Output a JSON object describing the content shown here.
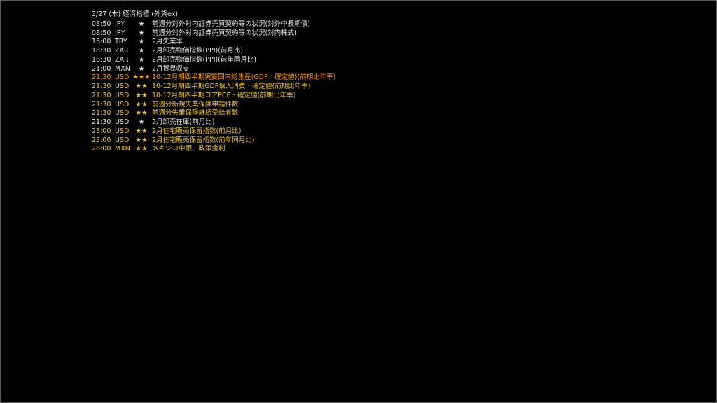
{
  "header": {
    "date_label": "3/27 (木) 経済指標 (外貨ex)"
  },
  "events": [
    {
      "time": "08:50",
      "currency": "JPY",
      "stars": "★",
      "title": "前週分対外対内証券売買契約等の状況(対外中長期債)",
      "color": "normal"
    },
    {
      "time": "08:50",
      "currency": "JPY",
      "stars": "★",
      "title": "前週分対外対内証券売買契約等の状況(対内株式)",
      "color": "normal"
    },
    {
      "time": "16:00",
      "currency": "TRY",
      "stars": "★",
      "title": "2月失業率",
      "color": "normal"
    },
    {
      "time": "18:30",
      "currency": "ZAR",
      "stars": "★",
      "title": "2月卸売物価指数(PPI)(前月比)",
      "color": "normal"
    },
    {
      "time": "18:30",
      "currency": "ZAR",
      "stars": "★",
      "title": "2月卸売物価指数(PPI)(前年同月比)",
      "color": "normal"
    },
    {
      "time": "21:00",
      "currency": "MXN",
      "stars": "★",
      "title": "2月貿易収支",
      "color": "normal"
    },
    {
      "time": "21:30",
      "currency": "USD",
      "stars": "★★★",
      "title": "10-12月期四半期実質国内総生産(GDP、確定値)(前期比年率)",
      "color": "orange"
    },
    {
      "time": "21:30",
      "currency": "USD",
      "stars": "★★",
      "title": "10-12月期四半期GDP個人消費・確定値(前期比年率)",
      "color": "gold"
    },
    {
      "time": "21:30",
      "currency": "USD",
      "stars": "★★",
      "title": "10-12月期四半期コアPCE・確定値(前期比年率)",
      "color": "gold"
    },
    {
      "time": "21:30",
      "currency": "USD",
      "stars": "★★",
      "title": "前週分新規失業保険申請件数",
      "color": "gold"
    },
    {
      "time": "21:30",
      "currency": "USD",
      "stars": "★★",
      "title": "前週分失業保険継続受給者数",
      "color": "gold"
    },
    {
      "time": "21:30",
      "currency": "USD",
      "stars": "★",
      "title": "2月卸売在庫(前月比)",
      "color": "normal"
    },
    {
      "time": "23:00",
      "currency": "USD",
      "stars": "★★",
      "title": "2月住宅販売保留指数(前月比)",
      "color": "gold"
    },
    {
      "time": "23:00",
      "currency": "USD",
      "stars": "★★",
      "title": "2月住宅販売保留指数(前年同月比)",
      "color": "gold"
    },
    {
      "time": "28:00",
      "currency": "MXN",
      "stars": "★★",
      "title": "メキシコ中銀、政策金利",
      "color": "gold"
    }
  ],
  "colors": {
    "normal": "#e6e6e6",
    "gold": "#f0c34a",
    "orange": "#ff9a1a",
    "background": "#000000"
  }
}
